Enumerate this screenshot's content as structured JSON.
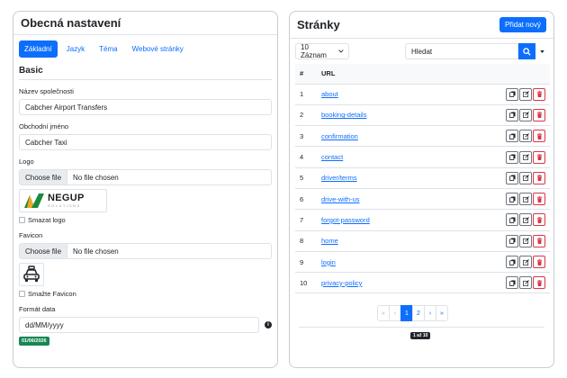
{
  "general": {
    "title": "Obecná nastavení",
    "tabs": [
      {
        "label": "Základní"
      },
      {
        "label": "Jazyk"
      },
      {
        "label": "Téma"
      },
      {
        "label": "Webové stránky"
      }
    ],
    "section_title": "Basic",
    "company_name_label": "Název společnosti",
    "company_name_value": "Cabcher Airport Transfers",
    "business_name_label": "Obchodní jméno",
    "business_name_value": "Cabcher Taxi",
    "logo_label": "Logo",
    "choose_file": "Choose file",
    "no_file": "No file chosen",
    "logo_text": "NEGUP",
    "logo_subtext": "SOLUTIONS",
    "delete_logo_label": "Smazat logo",
    "favicon_label": "Favicon",
    "delete_favicon_label": "Smažte Favicon",
    "date_format_label": "Formát data",
    "date_format_value": "dd/MM/yyyy",
    "date_preview": "01/06/2026"
  },
  "pages": {
    "title": "Stránky",
    "add_button": "Přidat nový",
    "per_page": "10 Záznam",
    "search_placeholder": "Hledat",
    "columns": [
      "#",
      "URL"
    ],
    "rows": [
      {
        "n": "1",
        "url": "about"
      },
      {
        "n": "2",
        "url": "booking-details"
      },
      {
        "n": "3",
        "url": "confirmation"
      },
      {
        "n": "4",
        "url": "contact"
      },
      {
        "n": "5",
        "url": "driver/terms"
      },
      {
        "n": "6",
        "url": "drive-with-us"
      },
      {
        "n": "7",
        "url": "forgot-password"
      },
      {
        "n": "8",
        "url": "home"
      },
      {
        "n": "9",
        "url": "login"
      },
      {
        "n": "10",
        "url": "privacy-policy"
      }
    ],
    "pagination": [
      "«",
      "‹",
      "1",
      "2",
      "›",
      "»"
    ],
    "page_info": "1 až 10"
  }
}
